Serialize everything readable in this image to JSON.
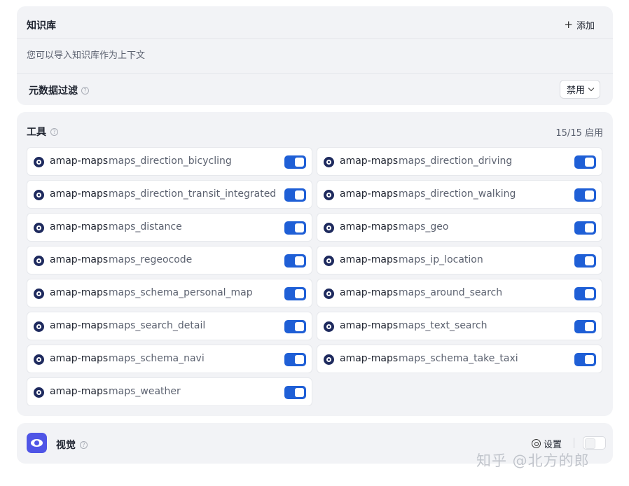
{
  "knowledge": {
    "title": "知识库",
    "add_label": "添加",
    "hint": "您可以导入知识库作为上下文",
    "filter_label": "元数据过滤",
    "filter_value": "禁用"
  },
  "tools": {
    "title": "工具",
    "count": "15/15 启用",
    "items": [
      {
        "server": "amap-maps",
        "name": "maps_direction_bicycling",
        "enabled": true
      },
      {
        "server": "amap-maps",
        "name": "maps_direction_driving",
        "enabled": true
      },
      {
        "server": "amap-maps",
        "name": "maps_direction_transit_integrated",
        "enabled": true
      },
      {
        "server": "amap-maps",
        "name": "maps_direction_walking",
        "enabled": true
      },
      {
        "server": "amap-maps",
        "name": "maps_distance",
        "enabled": true
      },
      {
        "server": "amap-maps",
        "name": "maps_geo",
        "enabled": true
      },
      {
        "server": "amap-maps",
        "name": "maps_regeocode",
        "enabled": true
      },
      {
        "server": "amap-maps",
        "name": "maps_ip_location",
        "enabled": true
      },
      {
        "server": "amap-maps",
        "name": "maps_schema_personal_map",
        "enabled": true
      },
      {
        "server": "amap-maps",
        "name": "maps_around_search",
        "enabled": true
      },
      {
        "server": "amap-maps",
        "name": "maps_search_detail",
        "enabled": true
      },
      {
        "server": "amap-maps",
        "name": "maps_text_search",
        "enabled": true
      },
      {
        "server": "amap-maps",
        "name": "maps_schema_navi",
        "enabled": true
      },
      {
        "server": "amap-maps",
        "name": "maps_schema_take_taxi",
        "enabled": true
      },
      {
        "server": "amap-maps",
        "name": "maps_weather",
        "enabled": true
      }
    ]
  },
  "vision": {
    "title": "视觉",
    "settings_label": "设置",
    "enabled": false
  },
  "watermark": "知乎 @北方的郎",
  "colors": {
    "toggle_on": "#1f5fd6",
    "vision_accent": "#4f55e6",
    "card_bg": "#f2f3f6"
  }
}
